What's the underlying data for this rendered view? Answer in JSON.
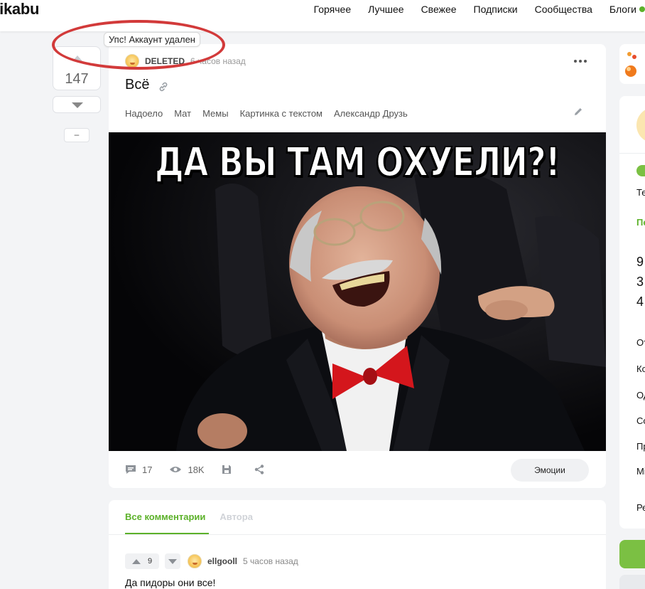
{
  "header": {
    "logo": "pikabu",
    "nav": [
      "Горячее",
      "Лучшее",
      "Свежее",
      "Подписки",
      "Сообщества",
      "Блоги"
    ]
  },
  "vote": {
    "count": "147",
    "collapse_label": "–"
  },
  "post": {
    "author": "DELETED",
    "time": "6 часов назад",
    "title": "Всё",
    "tags": [
      "Надоело",
      "Мат",
      "Мемы",
      "Картинка с текстом",
      "Александр Друзь"
    ],
    "image_caption": "ДА ВЫ ТАМ ОХУЕЛИ?!",
    "comments_count": "17",
    "views": "18K",
    "emotions_label": "Эмоции"
  },
  "tooltip": {
    "text": "Упс! Аккаунт удален"
  },
  "comments": {
    "tabs": [
      "Все комментарии",
      "Автора"
    ],
    "first": {
      "votes": "9",
      "author": "ellgooll",
      "time": "5 часов назад",
      "text": "Да пидоры они все!"
    }
  },
  "sidebar": {
    "texts": [
      "Те",
      "По",
      "От",
      "Ко",
      "Од",
      "Со",
      "Пр",
      "Мі",
      "Ре"
    ],
    "numbers": [
      "9",
      "3",
      "4"
    ]
  },
  "colors": {
    "accent": "#5cb12a",
    "annotation": "#d23a3a"
  }
}
